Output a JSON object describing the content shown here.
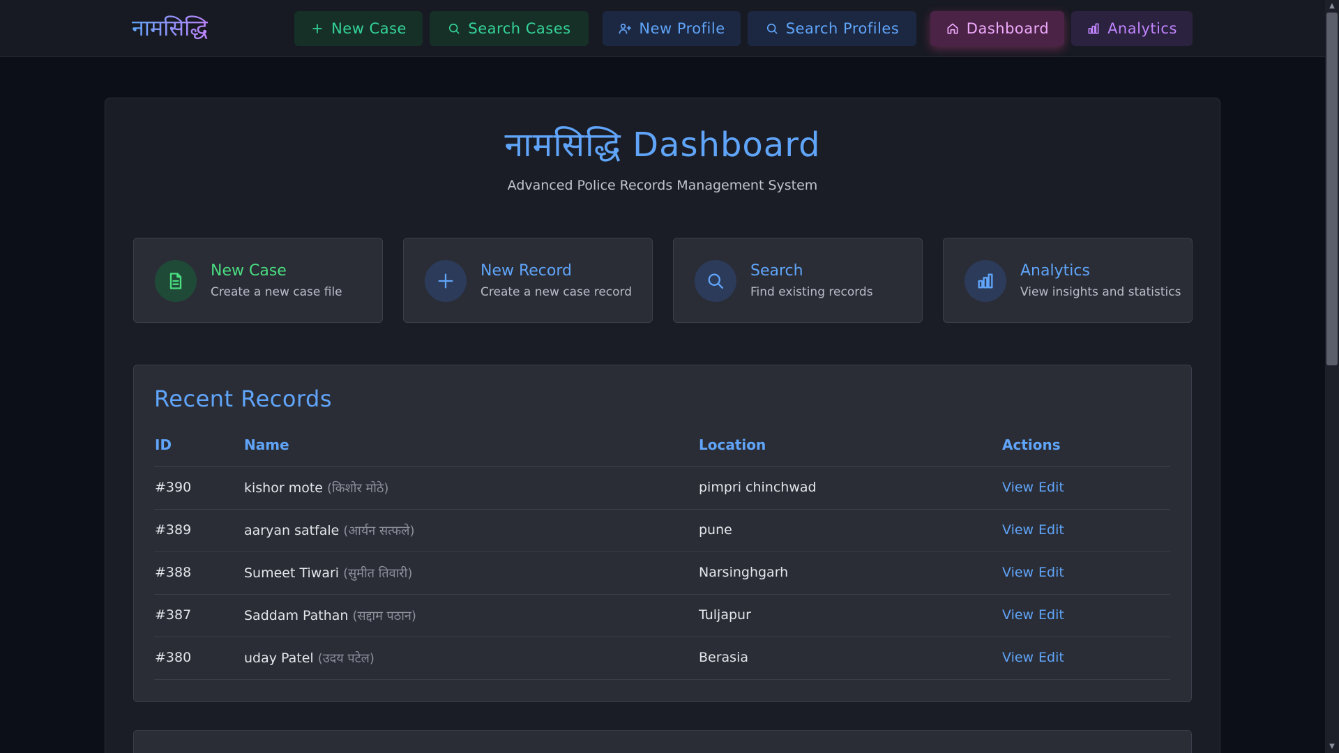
{
  "app": {
    "brand": "नामसिद्धि"
  },
  "nav": {
    "new_case": "New Case",
    "search_cases": "Search Cases",
    "new_profile": "New Profile",
    "search_profiles": "Search Profiles",
    "dashboard": "Dashboard",
    "analytics": "Analytics"
  },
  "page": {
    "title": "नामसिद्धि Dashboard",
    "subtitle": "Advanced Police Records Management System"
  },
  "cards": [
    {
      "title": "New Case",
      "desc": "Create a new case file",
      "icon": "document-icon"
    },
    {
      "title": "New Record",
      "desc": "Create a new case record",
      "icon": "plus-icon"
    },
    {
      "title": "Search",
      "desc": "Find existing records",
      "icon": "search-icon"
    },
    {
      "title": "Analytics",
      "desc": "View insights and statistics",
      "icon": "bar-chart-icon"
    }
  ],
  "records": {
    "title": "Recent Records",
    "headers": {
      "id": "ID",
      "name": "Name",
      "location": "Location",
      "actions": "Actions"
    },
    "view_label": "View",
    "edit_label": "Edit",
    "rows": [
      {
        "id": "#390",
        "name": "kishor mote",
        "name_dev": "(किशोर मोठे)",
        "location": "pimpri chinchwad"
      },
      {
        "id": "#389",
        "name": "aaryan satfale",
        "name_dev": "(आर्यन सत्फले)",
        "location": "pune"
      },
      {
        "id": "#388",
        "name": "Sumeet Tiwari",
        "name_dev": "(सुमीत तिवारी)",
        "location": "Narsinghgarh"
      },
      {
        "id": "#387",
        "name": "Saddam Pathan",
        "name_dev": "(सद्दाम पठान)",
        "location": "Tuljapur"
      },
      {
        "id": "#380",
        "name": "uday Patel",
        "name_dev": "(उदय पटेल)",
        "location": "Berasia"
      }
    ]
  },
  "colors": {
    "accent_blue": "#60a5fa",
    "accent_green": "#34d399",
    "accent_pink": "#f0abfc",
    "accent_purple": "#c084fc",
    "background": "#0c0f17",
    "panel": "#1a1d26"
  }
}
